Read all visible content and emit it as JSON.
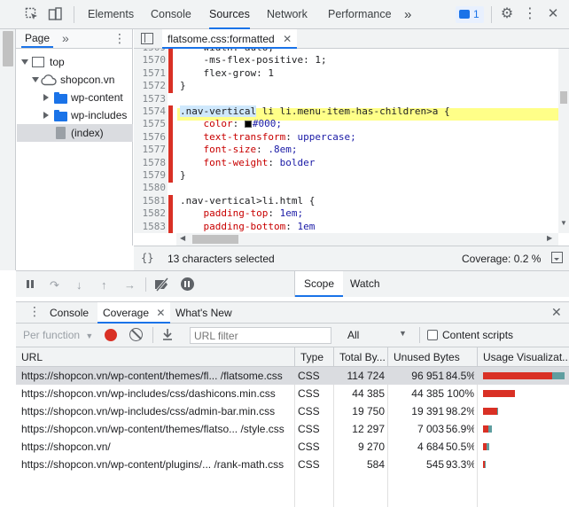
{
  "toolbar": {
    "tabs": [
      "Elements",
      "Console",
      "Sources",
      "Network",
      "Performance"
    ],
    "more": "»",
    "issues_count": "1",
    "settings_icon": "gear-icon",
    "menu_icon": "kebab-icon",
    "close_icon": "close-icon"
  },
  "navigator": {
    "tab": "Page",
    "more": "»",
    "tree": [
      {
        "label": "top",
        "icon": "frame-icon"
      },
      {
        "label": "shopcon.vn",
        "icon": "cloud-icon"
      },
      {
        "label": "wp-content",
        "icon": "folder-icon"
      },
      {
        "label": "wp-includes",
        "icon": "folder-icon"
      },
      {
        "label": "(index)",
        "icon": "file-icon"
      }
    ]
  },
  "editor": {
    "tab": "flatsome.css:formatted",
    "lines": [
      {
        "n": "1569",
        "code": "    width: auto;"
      },
      {
        "n": "1570",
        "code": "    -ms-flex-positive: 1;"
      },
      {
        "n": "1571",
        "code": "    flex-grow: 1"
      },
      {
        "n": "1572",
        "code": "}"
      },
      {
        "n": "1573",
        "code": ""
      },
      {
        "n": "1574",
        "sel": ".nav-vertical",
        "rest": " li li.menu-item-has-children>a {"
      },
      {
        "n": "1575",
        "prop": "color",
        "val": "#000;"
      },
      {
        "n": "1576",
        "prop": "text-transform",
        "val": "uppercase;"
      },
      {
        "n": "1577",
        "prop": "font-size",
        "val": ".8em;"
      },
      {
        "n": "1578",
        "prop": "font-weight",
        "val": "bolder"
      },
      {
        "n": "1579",
        "code": "}"
      },
      {
        "n": "1580",
        "code": ""
      },
      {
        "n": "1581",
        "code": ".nav-vertical>li.html {"
      },
      {
        "n": "1582",
        "prop": "padding-top",
        "val": "1em;"
      },
      {
        "n": "1583",
        "prop": "padding-bottom",
        "val": "1em"
      },
      {
        "n": "1584",
        "code": ""
      }
    ],
    "status": "13 characters selected",
    "coverage": "Coverage: 0.2 %"
  },
  "sidebar_tabs": [
    "Scope",
    "Watch"
  ],
  "drawer": {
    "tabs": [
      "Console",
      "Coverage",
      "What's New"
    ],
    "per_function": "Per function",
    "url_filter_placeholder": "URL filter",
    "type_select": "All",
    "content_scripts": "Content scripts",
    "columns": [
      "URL",
      "Type",
      "Total By...",
      "Unused Bytes",
      "Usage Visualizat..."
    ],
    "rows": [
      {
        "url": "https://shopcon.vn/wp-content/themes/fl...  /flatsome.css",
        "type": "CSS",
        "total": "114 724",
        "unused": "96 951",
        "pct": "84.5%",
        "total_bytes": 114724,
        "unused_fraction": 0.845
      },
      {
        "url": "https://shopcon.vn/wp-includes/css/dashicons.min.css",
        "type": "CSS",
        "total": "44 385",
        "unused": "44 385",
        "pct": "100%",
        "total_bytes": 44385,
        "unused_fraction": 1.0
      },
      {
        "url": "https://shopcon.vn/wp-includes/css/admin-bar.min.css",
        "type": "CSS",
        "total": "19 750",
        "unused": "19 391",
        "pct": "98.2%",
        "total_bytes": 19750,
        "unused_fraction": 0.982
      },
      {
        "url": "https://shopcon.vn/wp-content/themes/flatso...  /style.css",
        "type": "CSS",
        "total": "12 297",
        "unused": "7 003",
        "pct": "56.9%",
        "total_bytes": 12297,
        "unused_fraction": 0.569
      },
      {
        "url": "https://shopcon.vn/",
        "type": "CSS",
        "total": "9 270",
        "unused": "4 684",
        "pct": "50.5%",
        "total_bytes": 9270,
        "unused_fraction": 0.505
      },
      {
        "url": "https://shopcon.vn/wp-content/plugins/...  /rank-math.css",
        "type": "CSS",
        "total": "584",
        "unused": "545",
        "pct": "93.3%",
        "total_bytes": 584,
        "unused_fraction": 0.933
      }
    ]
  },
  "colors": {
    "accent": "#1a73e8",
    "unused": "#d93025",
    "used": "#5f9ea0",
    "selected_row": "#dadce0"
  }
}
